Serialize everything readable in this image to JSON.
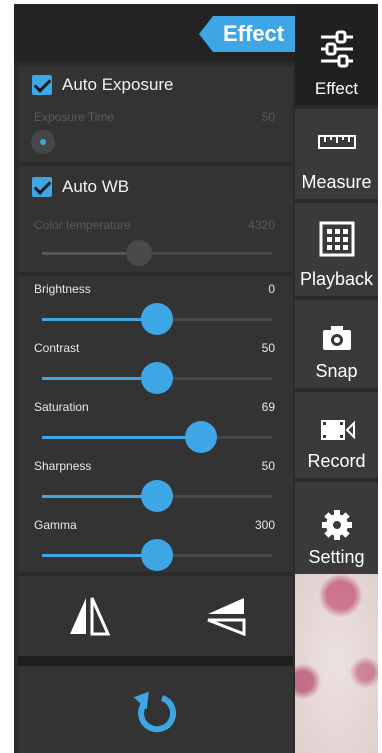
{
  "header": {
    "title": "Effect"
  },
  "exposure": {
    "auto_label": "Auto Exposure",
    "auto_checked": true,
    "time_label": "Exposure Time",
    "time_value": "50",
    "time_level": 0.0
  },
  "wb": {
    "auto_label": "Auto WB",
    "auto_checked": true,
    "temp_label": "Color temperature",
    "temp_value": "4320",
    "temp_level": 0.42
  },
  "sliders": [
    {
      "label": "Brightness",
      "value": "0",
      "level": 0.5
    },
    {
      "label": "Contrast",
      "value": "50",
      "level": 0.5
    },
    {
      "label": "Saturation",
      "value": "69",
      "level": 0.69
    },
    {
      "label": "Sharpness",
      "value": "50",
      "level": 0.5
    },
    {
      "label": "Gamma",
      "value": "300",
      "level": 0.5
    }
  ],
  "nav": [
    {
      "label": "Effect",
      "icon": "sliders-icon",
      "active": true
    },
    {
      "label": "Measure",
      "icon": "ruler-icon",
      "active": false
    },
    {
      "label": "Playback",
      "icon": "grid-icon",
      "active": false
    },
    {
      "label": "Snap",
      "icon": "camera-icon",
      "active": false
    },
    {
      "label": "Record",
      "icon": "video-icon",
      "active": false
    },
    {
      "label": "Setting",
      "icon": "gear-icon",
      "active": false
    }
  ],
  "colors": {
    "accent": "#3fa6e6",
    "panel": "#333333",
    "background": "#2b2b2b"
  }
}
